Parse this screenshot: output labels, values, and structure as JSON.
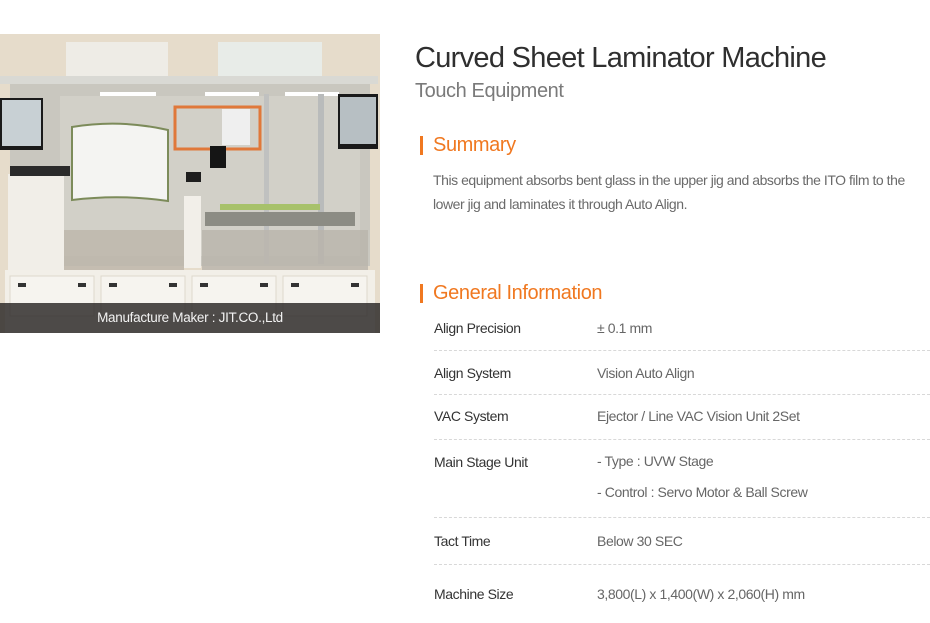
{
  "product": {
    "title": "Curved Sheet Laminator Machine",
    "category": "Touch Equipment",
    "image_alt": "Curved Sheet Laminator Machine photo",
    "caption": "Manufacture Maker : JIT.CO.,Ltd"
  },
  "summary": {
    "heading": "Summary",
    "text": "This equipment absorbs bent glass in the upper jig and absorbs the ITO film to the lower jig and laminates it through Auto Align."
  },
  "general": {
    "heading": "General Information",
    "rows": [
      {
        "label": "Align Precision",
        "values": [
          "± 0.1 mm"
        ]
      },
      {
        "label": "Align System",
        "values": [
          "Vision Auto Align"
        ]
      },
      {
        "label": "VAC System",
        "values": [
          "Ejector / Line VAC Vision Unit 2Set"
        ]
      },
      {
        "label": "Main Stage Unit",
        "values": [
          "- Type : UVW Stage",
          "- Control : Servo Motor & Ball Screw"
        ]
      },
      {
        "label": "Tact Time",
        "values": [
          "Below 30 SEC"
        ]
      },
      {
        "label": "Machine Size",
        "values": [
          "3,800(L) x 1,400(W) x 2,060(H) mm"
        ]
      }
    ]
  },
  "colors": {
    "accent": "#f07820",
    "title": "#2f2f2f",
    "subtitle": "#7a7a7a",
    "divider": "#d8d8d8"
  }
}
